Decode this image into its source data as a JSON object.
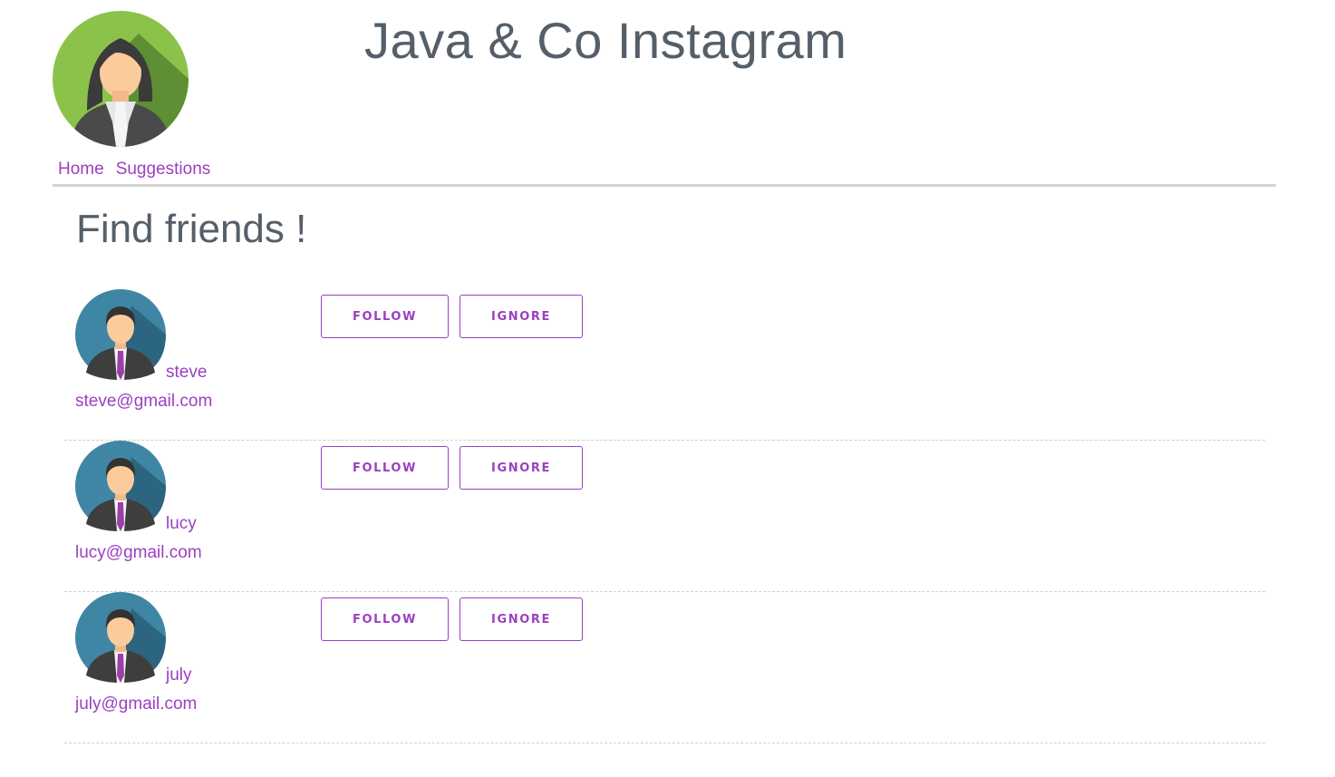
{
  "header": {
    "title": "Java & Co Instagram",
    "profile_avatar_icon": "female-user-avatar-icon"
  },
  "nav": {
    "home_label": "Home",
    "suggestions_label": "Suggestions"
  },
  "main": {
    "heading": "Find friends !",
    "friend_avatar_icon": "male-user-avatar-icon",
    "friends": [
      {
        "name": "steve",
        "email": "steve@gmail.com",
        "follow_label": "FOLLOW",
        "ignore_label": "IGNORE"
      },
      {
        "name": "lucy",
        "email": "lucy@gmail.com",
        "follow_label": "FOLLOW",
        "ignore_label": "IGNORE"
      },
      {
        "name": "july",
        "email": "july@gmail.com",
        "follow_label": "FOLLOW",
        "ignore_label": "IGNORE"
      }
    ]
  },
  "colors": {
    "accent": "#9b3fc2",
    "text": "#545f69",
    "profile_bg": "#8bc34a",
    "friend_avatar_bg": "#3f86a4"
  }
}
